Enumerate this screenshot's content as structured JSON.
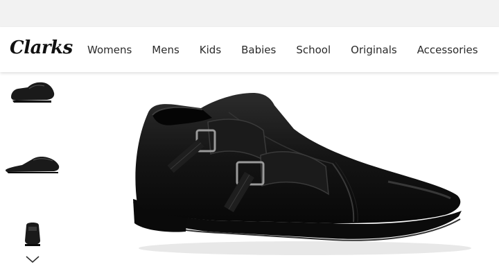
{
  "brand": {
    "logo_text": "Clarks"
  },
  "nav": {
    "items": [
      {
        "label": "Womens"
      },
      {
        "label": "Mens"
      },
      {
        "label": "Kids"
      },
      {
        "label": "Babies"
      },
      {
        "label": "School"
      },
      {
        "label": "Originals"
      },
      {
        "label": "Accessories"
      }
    ]
  },
  "gallery": {
    "thumbnails": [
      {
        "icon": "shoe-angle-view"
      },
      {
        "icon": "shoe-side-view"
      },
      {
        "icon": "shoe-front-view"
      }
    ],
    "scroll_icon": "chevron-down-icon",
    "main_image_icon": "black-leather-monk-strap-shoe"
  },
  "colors": {
    "top_strip": "#f2f2f2",
    "nav_text": "#2a2a2a",
    "shoe": "#141414"
  }
}
